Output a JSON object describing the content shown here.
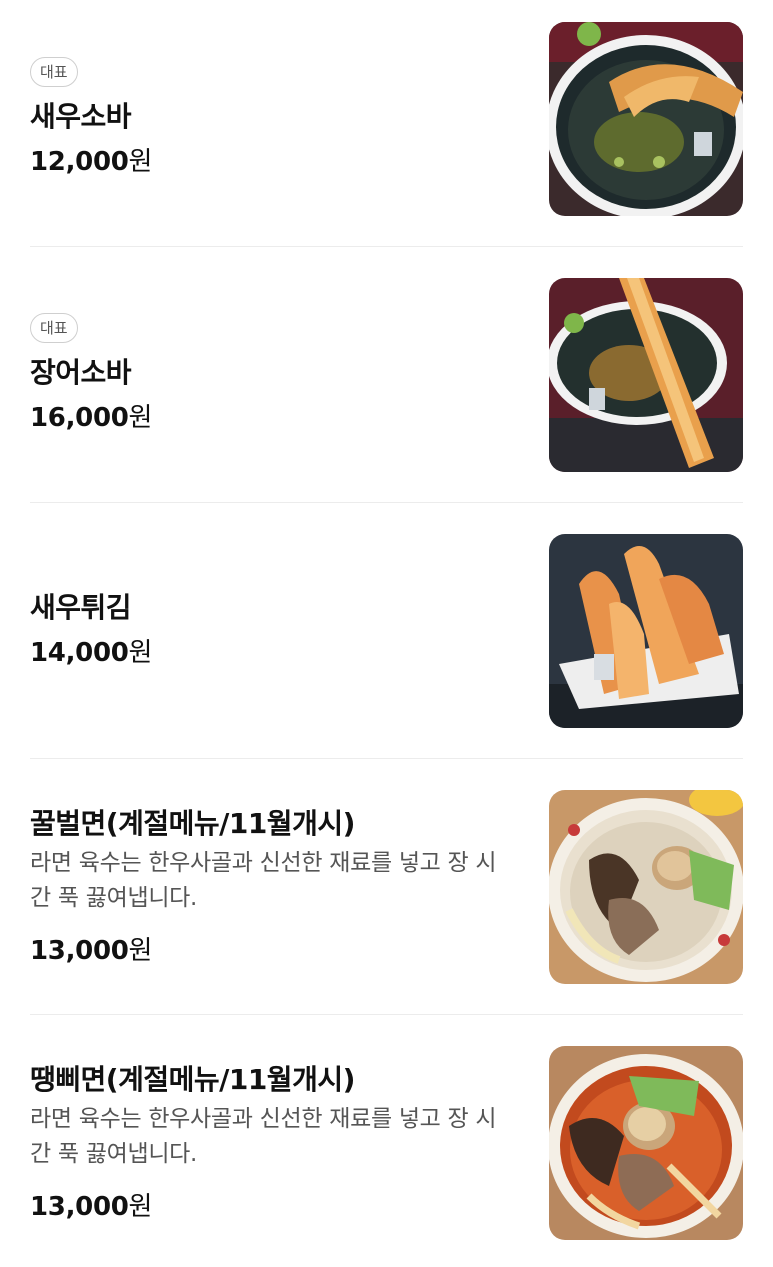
{
  "menu": {
    "items": [
      {
        "badge": "대표",
        "name": "새우소바",
        "description": "",
        "price": "12,000",
        "currency": "원",
        "photo": "shrimp-soba-photo"
      },
      {
        "badge": "대표",
        "name": "장어소바",
        "description": "",
        "price": "16,000",
        "currency": "원",
        "photo": "eel-soba-photo"
      },
      {
        "badge": "",
        "name": "새우튀김",
        "description": "",
        "price": "14,000",
        "currency": "원",
        "photo": "shrimp-tempura-photo"
      },
      {
        "badge": "",
        "name": "꿀벌면(계절메뉴/11월개시)",
        "description": "라면 육수는 한우사골과 신선한 재료를 넣고 장 시간 푹 끓여냅니다.",
        "price": "13,000",
        "currency": "원",
        "photo": "ramen-white-broth-photo"
      },
      {
        "badge": "",
        "name": "땡삐면(계절메뉴/11월개시)",
        "description": "라면 육수는 한우사골과 신선한 재료를 넣고 장 시간 푹 끓여냅니다.",
        "price": "13,000",
        "currency": "원",
        "photo": "ramen-spicy-broth-photo"
      }
    ]
  }
}
